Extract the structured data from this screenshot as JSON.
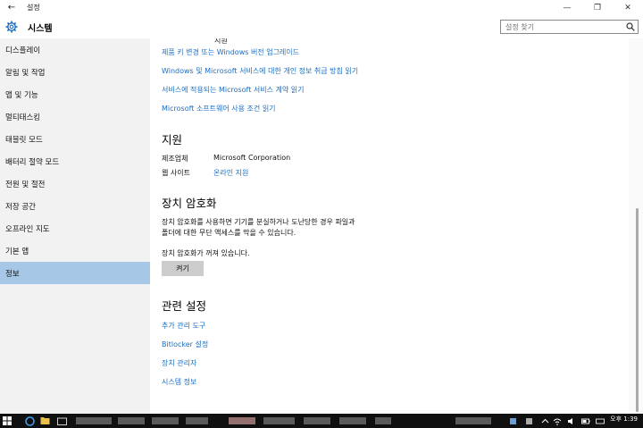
{
  "window": {
    "title": "설정",
    "back_glyph": "←",
    "minimize_glyph": "—",
    "maximize_glyph": "❐",
    "close_glyph": "✕"
  },
  "header": {
    "title": "시스템",
    "icon": "gear-icon",
    "search_placeholder": "설정 찾기"
  },
  "sidebar": {
    "items": [
      {
        "label": "디스플레이"
      },
      {
        "label": "알림 및 작업"
      },
      {
        "label": "앱 및 기능"
      },
      {
        "label": "멀티태스킹"
      },
      {
        "label": "태블릿 모드"
      },
      {
        "label": "배터리 절약 모드"
      },
      {
        "label": "전원 및 절전"
      },
      {
        "label": "저장 공간"
      },
      {
        "label": "오프라인 지도"
      },
      {
        "label": "기본 앱"
      },
      {
        "label": "정보"
      }
    ],
    "active_index": 10
  },
  "main": {
    "cut_text": "지원",
    "top_links": [
      "제품 키 변경 또는 Windows 버전 업그레이드",
      "Windows 및 Microsoft 서비스에 대한 개인 정보 취급 방침 읽기",
      "서비스에 적용되는 Microsoft 서비스 계약 읽기",
      "Microsoft 소프트웨어 사용 조건 읽기"
    ],
    "support": {
      "title": "지원",
      "manufacturer_label": "제조업체",
      "manufacturer_value": "Microsoft Corporation",
      "website_label": "웹 사이트",
      "website_value": "온라인 지원"
    },
    "encryption": {
      "title": "장치 암호화",
      "description_line1": "장치 암호화를 사용하면 기기를 분실하거나 도난당한 경우 파일과",
      "description_line2": "폴더에 대한 무단 액세스를 막을 수 있습니다.",
      "status": "장치 암호화가 꺼져 있습니다.",
      "button_label": "켜기"
    },
    "related": {
      "title": "관련 설정",
      "links": [
        "추가 관리 도구",
        "Bitlocker 설정",
        "장치 관리자",
        "시스템 정보"
      ]
    }
  },
  "taskbar": {
    "clock": "오후 1:39",
    "accent": "#1a6fc4"
  }
}
